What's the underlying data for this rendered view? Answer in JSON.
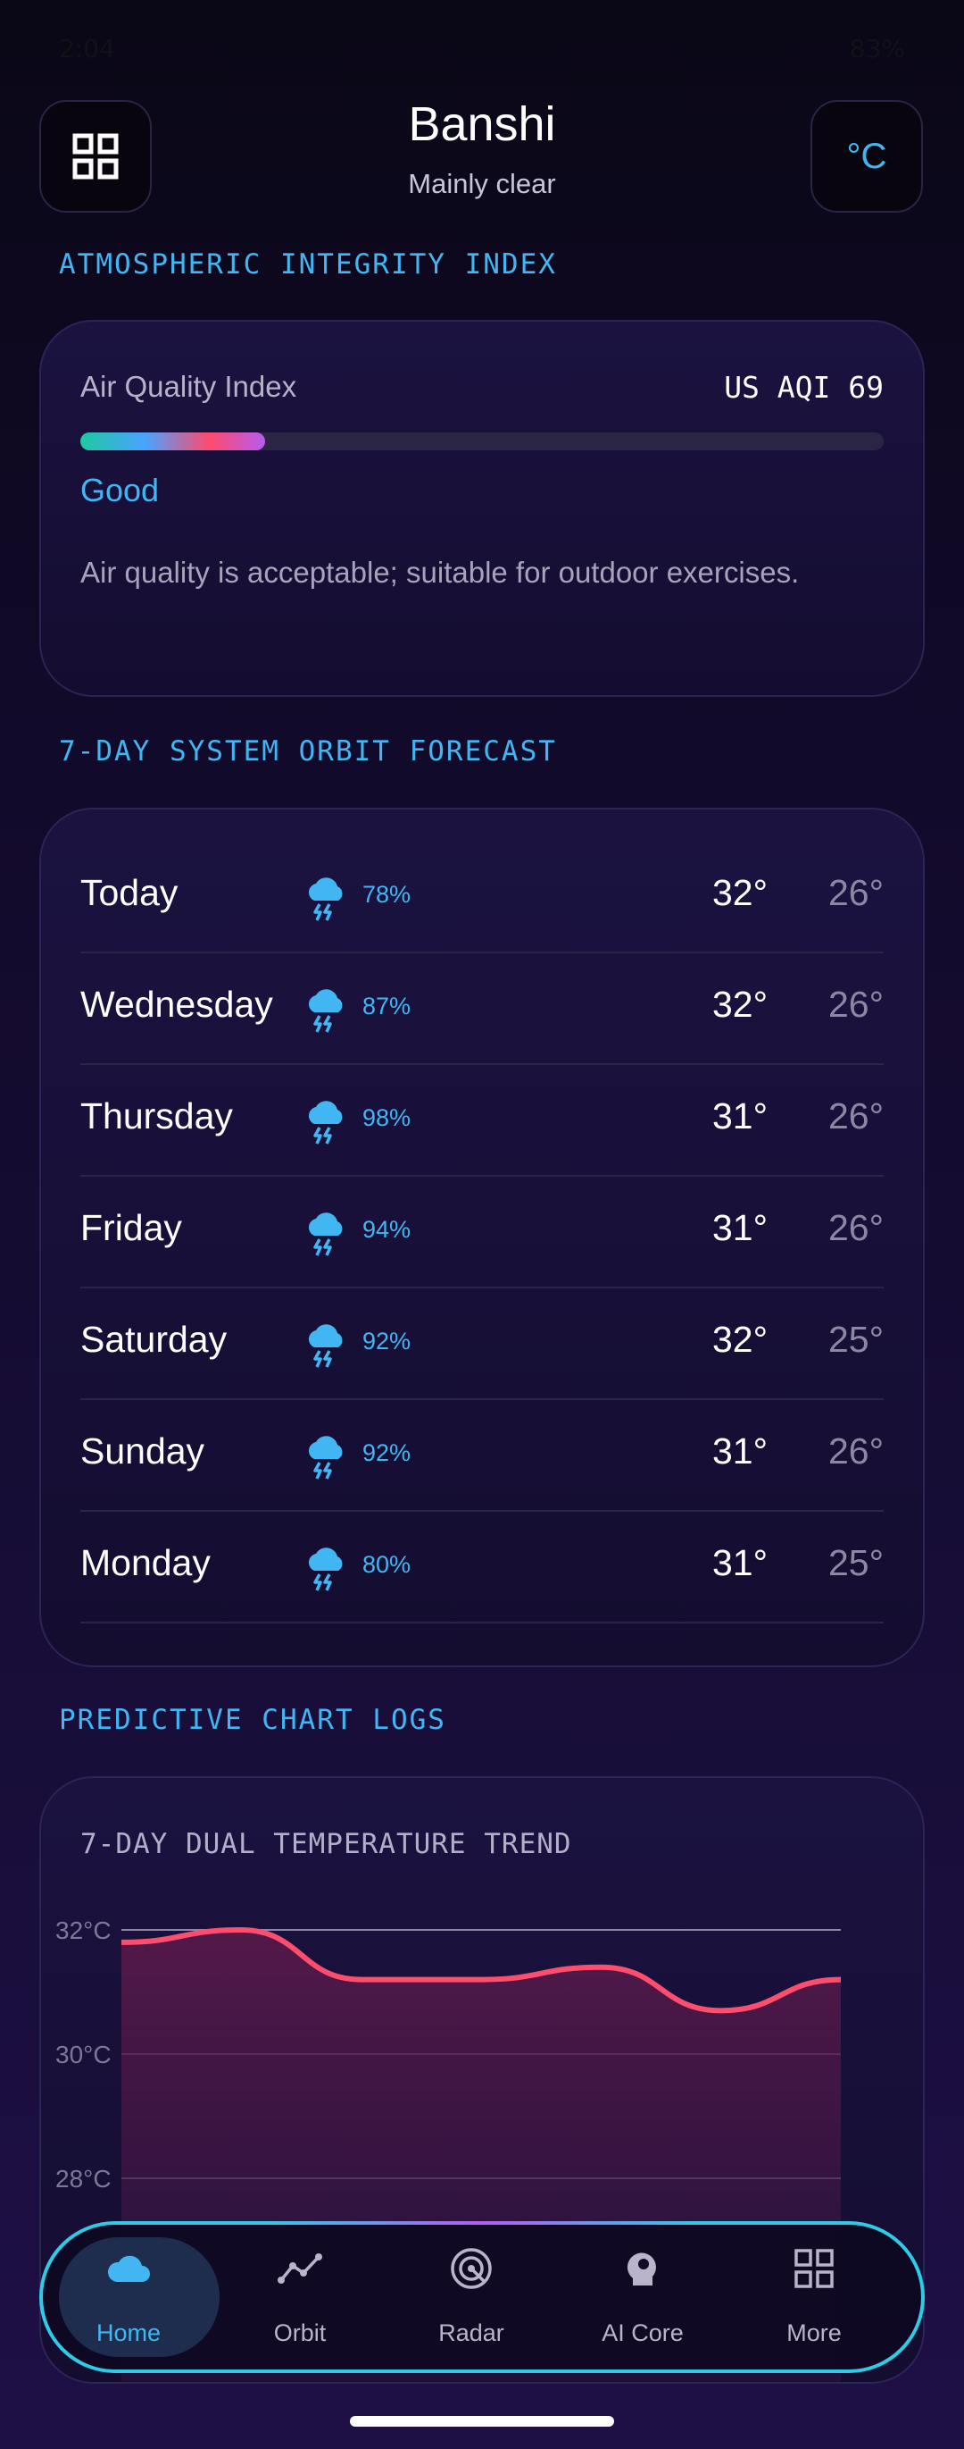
{
  "status_bar": {
    "time": "2:04",
    "right": "83%"
  },
  "header": {
    "city": "Banshi",
    "condition": "Mainly clear",
    "unit_button": "°C"
  },
  "aqi": {
    "section_title": "ATMOSPHERIC INTEGRITY INDEX",
    "label": "Air Quality Index",
    "value_text": "US AQI 69",
    "level_fraction": 0.23,
    "category": "Good",
    "description": "Air quality is acceptable; suitable for outdoor exercises."
  },
  "forecast": {
    "section_title": "7-DAY SYSTEM ORBIT FORECAST",
    "days": [
      {
        "day": "Today",
        "pop": "78%",
        "hi": "32°",
        "lo": "26°",
        "icon": "thunderstorm-cloud-icon"
      },
      {
        "day": "Wednesday",
        "pop": "87%",
        "hi": "32°",
        "lo": "26°",
        "icon": "thunderstorm-cloud-icon"
      },
      {
        "day": "Thursday",
        "pop": "98%",
        "hi": "31°",
        "lo": "26°",
        "icon": "thunderstorm-cloud-icon"
      },
      {
        "day": "Friday",
        "pop": "94%",
        "hi": "31°",
        "lo": "26°",
        "icon": "thunderstorm-cloud-icon"
      },
      {
        "day": "Saturday",
        "pop": "92%",
        "hi": "32°",
        "lo": "25°",
        "icon": "thunderstorm-cloud-icon"
      },
      {
        "day": "Sunday",
        "pop": "92%",
        "hi": "31°",
        "lo": "26°",
        "icon": "thunderstorm-cloud-icon"
      },
      {
        "day": "Monday",
        "pop": "80%",
        "hi": "31°",
        "lo": "25°",
        "icon": "thunderstorm-cloud-icon"
      }
    ]
  },
  "charts": {
    "section_title": "PREDICTIVE CHART LOGS",
    "card_title": "7-DAY DUAL TEMPERATURE TREND"
  },
  "chart_data": {
    "type": "area",
    "title": "7-DAY DUAL TEMPERATURE TREND",
    "y_tick_labels": [
      "32°C",
      "30°C",
      "28°C"
    ],
    "y_ticks": [
      32,
      30,
      28
    ],
    "ylim": [
      24,
      32
    ],
    "grid": true,
    "series": [
      {
        "values": [
          31.8,
          32.0,
          31.2,
          31.2,
          31.4,
          30.7,
          31.2
        ],
        "color": "#ff4d6d"
      }
    ]
  },
  "nav": {
    "items": [
      {
        "label": "Home",
        "icon": "cloud-icon",
        "active": true
      },
      {
        "label": "Orbit",
        "icon": "trend-line-icon",
        "active": false
      },
      {
        "label": "Radar",
        "icon": "radar-icon",
        "active": false
      },
      {
        "label": "AI Core",
        "icon": "brain-gear-icon",
        "active": false
      },
      {
        "label": "More",
        "icon": "grid-icon",
        "active": false
      }
    ]
  },
  "colors": {
    "accent": "#41b6f2",
    "nav_border": "#2ecbe6",
    "trend_line": "#ff4d6d"
  }
}
